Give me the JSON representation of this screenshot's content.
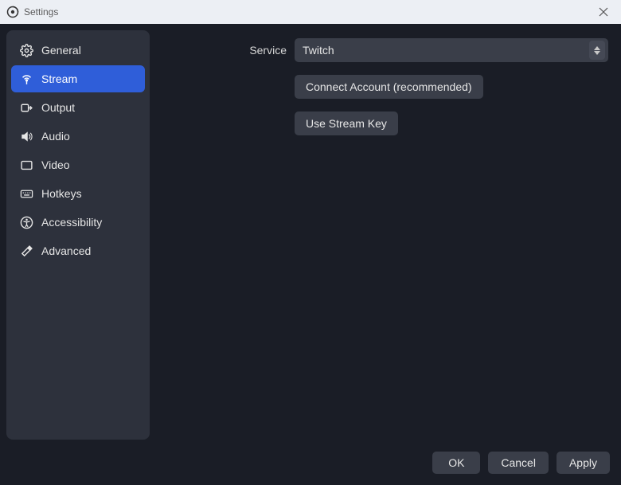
{
  "window": {
    "title": "Settings"
  },
  "sidebar": {
    "items": [
      {
        "label": "General"
      },
      {
        "label": "Stream"
      },
      {
        "label": "Output"
      },
      {
        "label": "Audio"
      },
      {
        "label": "Video"
      },
      {
        "label": "Hotkeys"
      },
      {
        "label": "Accessibility"
      },
      {
        "label": "Advanced"
      }
    ],
    "active_index": 1
  },
  "stream_panel": {
    "service_label": "Service",
    "service_value": "Twitch",
    "connect_button": "Connect Account (recommended)",
    "stream_key_button": "Use Stream Key"
  },
  "footer": {
    "ok": "OK",
    "cancel": "Cancel",
    "apply": "Apply"
  }
}
